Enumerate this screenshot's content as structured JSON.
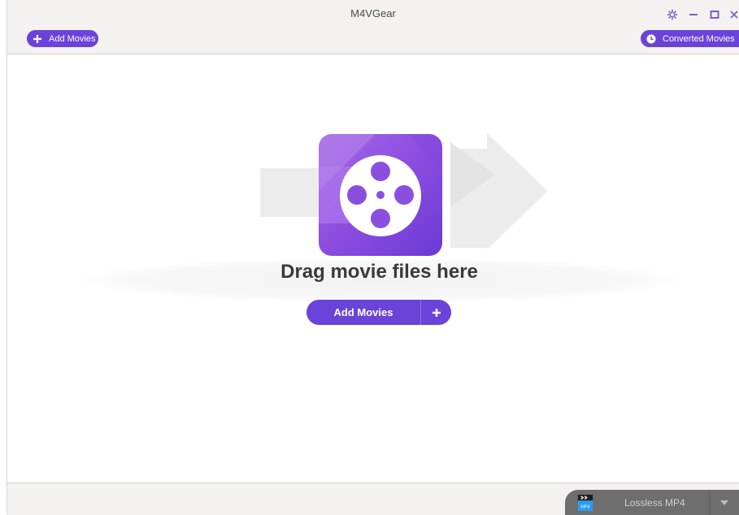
{
  "window": {
    "title": "M4VGear"
  },
  "toolbar": {
    "add_movies_label": "Add Movies",
    "converted_movies_label": "Converted Movies"
  },
  "dropzone": {
    "headline": "Drag movie files here",
    "add_movies_label": "Add Movies"
  },
  "footer": {
    "output_format": "Lossless MP4",
    "format_icon_text": "MP4"
  },
  "icons": {
    "settings": "gear-icon",
    "minimize": "minimize-icon",
    "maximize": "maximize-icon",
    "close": "close-icon",
    "add": "plus-icon",
    "converted": "clock-icon",
    "film": "film-reel-icon",
    "dropdown": "chevron-down-icon"
  },
  "colors": {
    "accent": "#6a43d9",
    "accent_light": "#9a5ee6",
    "titlebar_bg": "#f3f2f1",
    "format_bg": "#6e6e6e"
  }
}
